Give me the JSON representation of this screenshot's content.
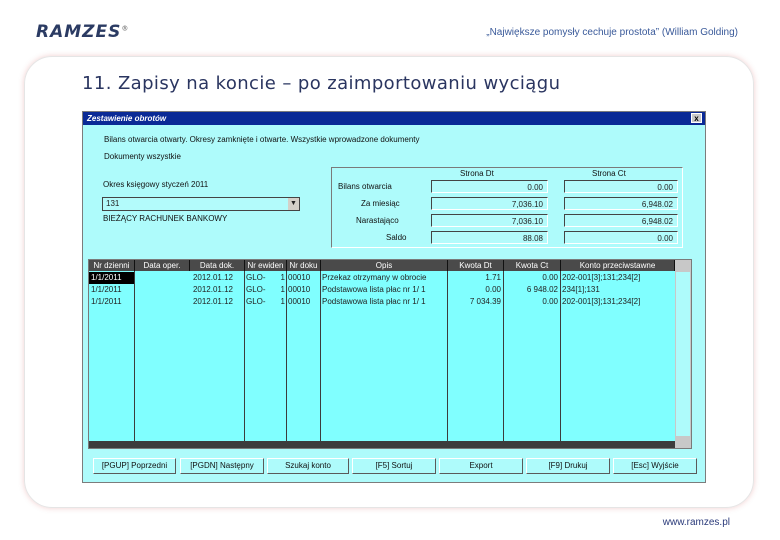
{
  "header": {
    "logo_text": "RAMZES",
    "logo_mark": "®",
    "quote": "„Największe pomysły cechuje prostota” (William Golding)"
  },
  "slide": {
    "title": "11. Zapisy na koncie – po zaimportowaniu wyciągu",
    "footer_url": "www.ramzes.pl"
  },
  "window": {
    "title": "Zestawienie obrotów",
    "close_label": "x",
    "info_line1": "Bilans otwarcia otwarty. Okresy zamknięte i otwarte. Wszystkie wprowadzone dokumenty",
    "info_line2": "Dokumenty wszystkie",
    "period_label": "Okres księgowy styczeń 2011",
    "account_value": "131",
    "account_name": "BIEŻĄCY RACHUNEK BANKOWY",
    "summary": {
      "col_dt": "Strona Dt",
      "col_ct": "Strona Ct",
      "rows": [
        {
          "label": "Bilans otwarcia",
          "dt": "0.00",
          "ct": "0.00"
        },
        {
          "label": "Za miesiąc",
          "dt": "7,036.10",
          "ct": "6,948.02"
        },
        {
          "label": "Narastająco",
          "dt": "7,036.10",
          "ct": "6,948.02"
        }
      ],
      "saldo_label": "Saldo",
      "saldo_dt": "88.08",
      "saldo_ct": "0.00"
    },
    "grid": {
      "columns": [
        "Nr dzienni",
        "Data oper.",
        "Data dok.",
        "Nr ewiden",
        "Nr doku",
        "Opis",
        "Kwota Dt",
        "Kwota Ct",
        "Konto przeciwstawne"
      ],
      "rows": [
        [
          "1/1/2011",
          "",
          "2012.01.12",
          "GLO-",
          "1",
          "00010",
          "Przekaz otrzymany w obrocie",
          "1.71",
          "0.00",
          "202-001[3];131;234[2]"
        ],
        [
          "1/1/2011",
          "",
          "2012.01.12",
          "GLO-",
          "1",
          "00010",
          "Podstawowa lista płac nr 1/ 1",
          "0.00",
          "6 948.02",
          "234[1];131"
        ],
        [
          "1/1/2011",
          "",
          "2012.01.12",
          "GLO-",
          "1",
          "00010",
          "Podstawowa lista płac nr 1/ 1",
          "7 034.39",
          "0.00",
          "202-001[3];131;234[2]"
        ]
      ]
    },
    "buttons": [
      "[PGUP] Poprzedni",
      "[PGDN] Następny",
      "Szukaj konto",
      "[F5] Sortuj",
      "Export",
      "[F9] Drukuj",
      "[Esc] Wyjście"
    ]
  }
}
